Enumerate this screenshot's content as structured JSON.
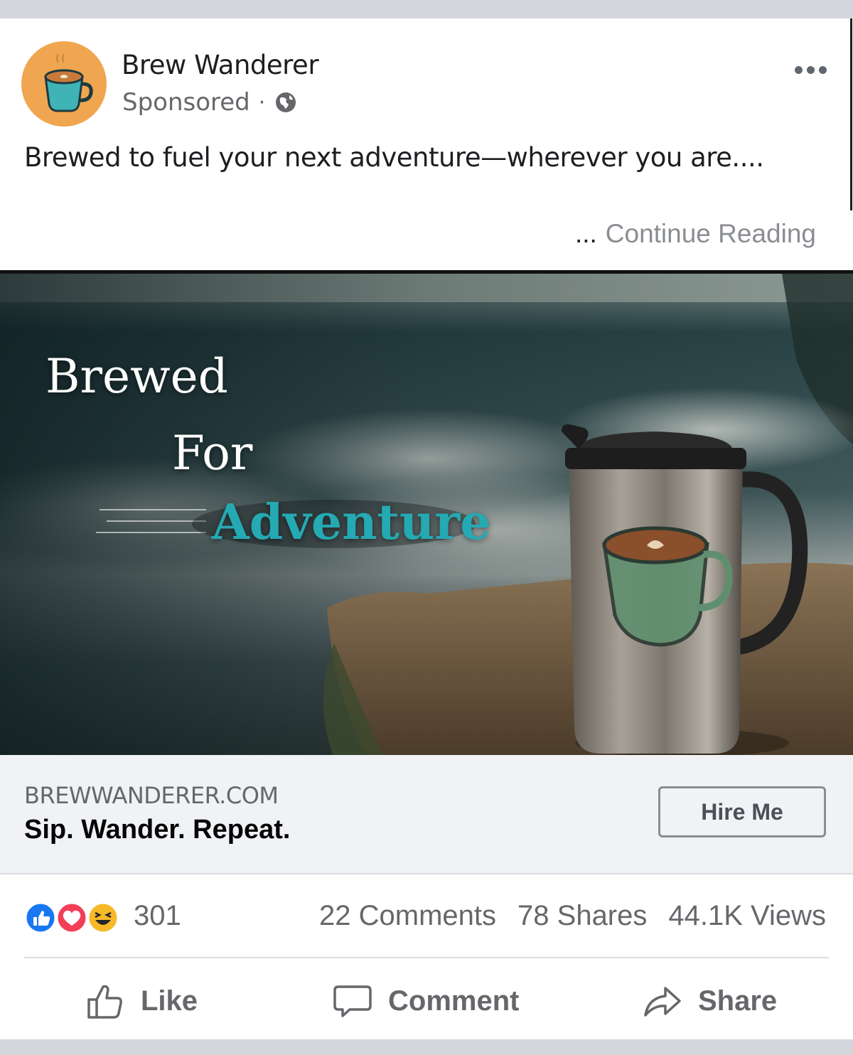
{
  "post": {
    "page_name": "Brew Wanderer",
    "sponsored": "Sponsored",
    "meta_separator": "·",
    "caption": "Brewed to fuel your next adventure—wherever you are....",
    "continue_ellipsis": "...",
    "continue_label": "Continue Reading"
  },
  "hero": {
    "line1": "Brewed",
    "line2": "For",
    "line3": "Adventure"
  },
  "link": {
    "domain": "BREWWANDERER.COM",
    "headline": "Sip. Wander. Repeat.",
    "cta_label": "Hire Me"
  },
  "stats": {
    "reactions": "301",
    "comments": "22 Comments",
    "shares": "78 Shares",
    "views": "44.1K Views"
  },
  "actions": {
    "like": "Like",
    "comment": "Comment",
    "share": "Share"
  },
  "colors": {
    "accent_teal": "#25a9b2",
    "avatar_bg": "#f0a650",
    "like_blue": "#1877f2",
    "love_red": "#f33e58",
    "haha_yellow": "#f7b928"
  }
}
